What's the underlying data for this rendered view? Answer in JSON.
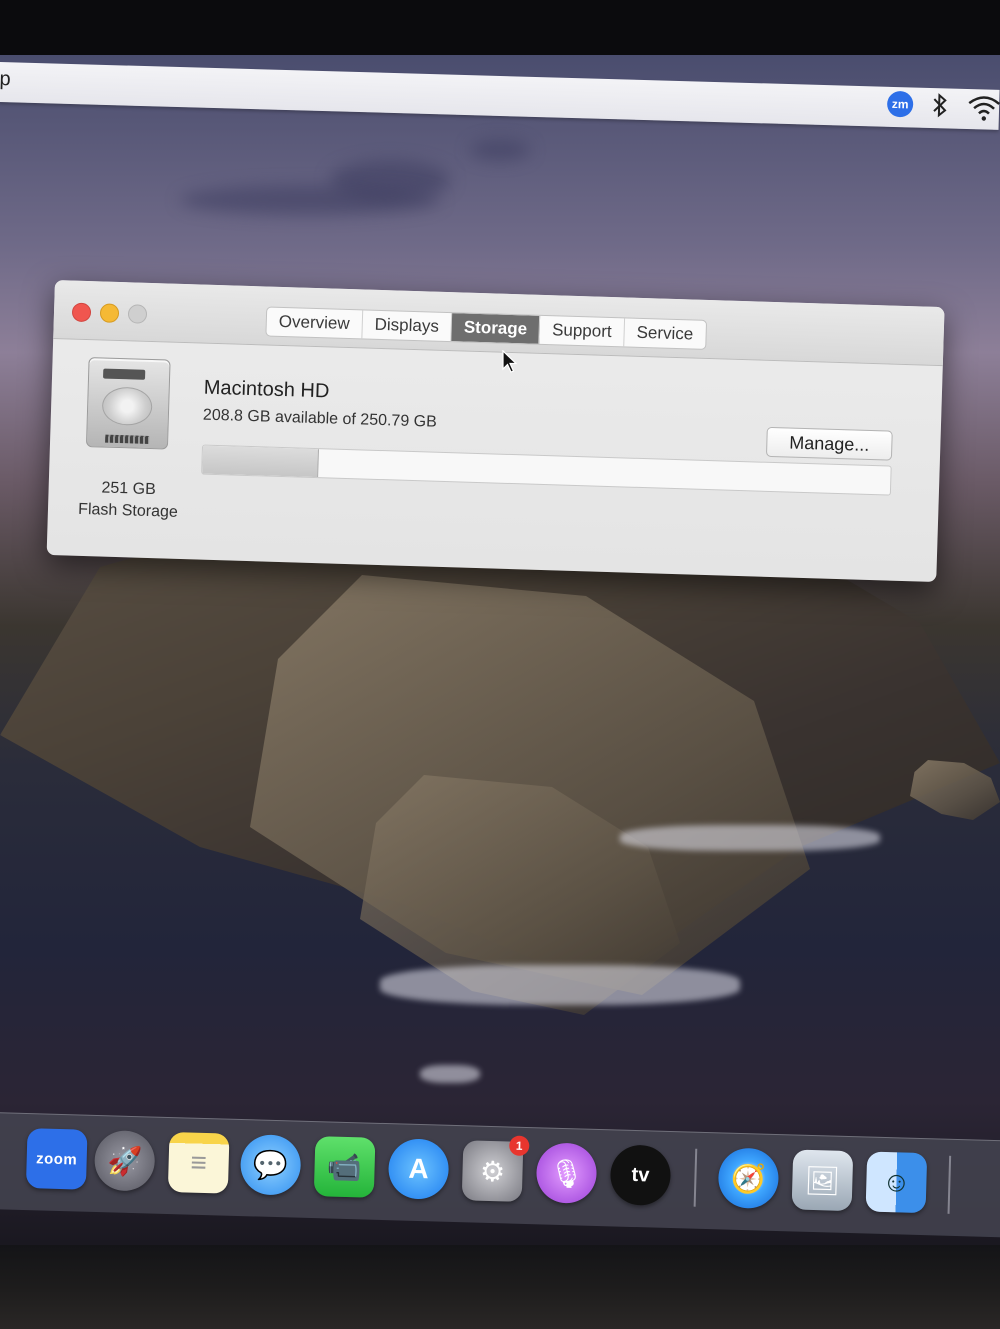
{
  "menubar": {
    "app_menu_fragment": "p",
    "status_icons": [
      "zoom-status-icon",
      "bluetooth-icon",
      "wifi-icon"
    ],
    "zoom_status_text": "zm"
  },
  "window": {
    "tabs": [
      {
        "label": "Overview",
        "active": false
      },
      {
        "label": "Displays",
        "active": false
      },
      {
        "label": "Storage",
        "active": true
      },
      {
        "label": "Support",
        "active": false
      },
      {
        "label": "Service",
        "active": false
      }
    ],
    "disk": {
      "capacity_label": "251 GB",
      "type_label": "Flash Storage",
      "name": "Macintosh HD",
      "availability": "208.8 GB available of 250.79 GB",
      "used_fraction": 0.167
    },
    "manage_button": "Manage..."
  },
  "dock": {
    "items": [
      {
        "name": "zoom-icon",
        "label": "zoom"
      },
      {
        "name": "launchpad-icon"
      },
      {
        "name": "notes-icon"
      },
      {
        "name": "messages-icon"
      },
      {
        "name": "facetime-icon"
      },
      {
        "name": "app-store-icon"
      },
      {
        "name": "system-preferences-icon",
        "badge": "1"
      },
      {
        "name": "podcasts-icon"
      },
      {
        "name": "apple-tv-icon",
        "label": "tv"
      },
      {
        "name": "safari-icon"
      },
      {
        "name": "preview-icon"
      },
      {
        "name": "finder-icon"
      }
    ]
  },
  "colors": {
    "close": "#f0564f",
    "minimize": "#f5b935",
    "active_tab": "#6e6e6e",
    "zoom_blue": "#2d6fe8",
    "badge_red": "#e8352e"
  }
}
